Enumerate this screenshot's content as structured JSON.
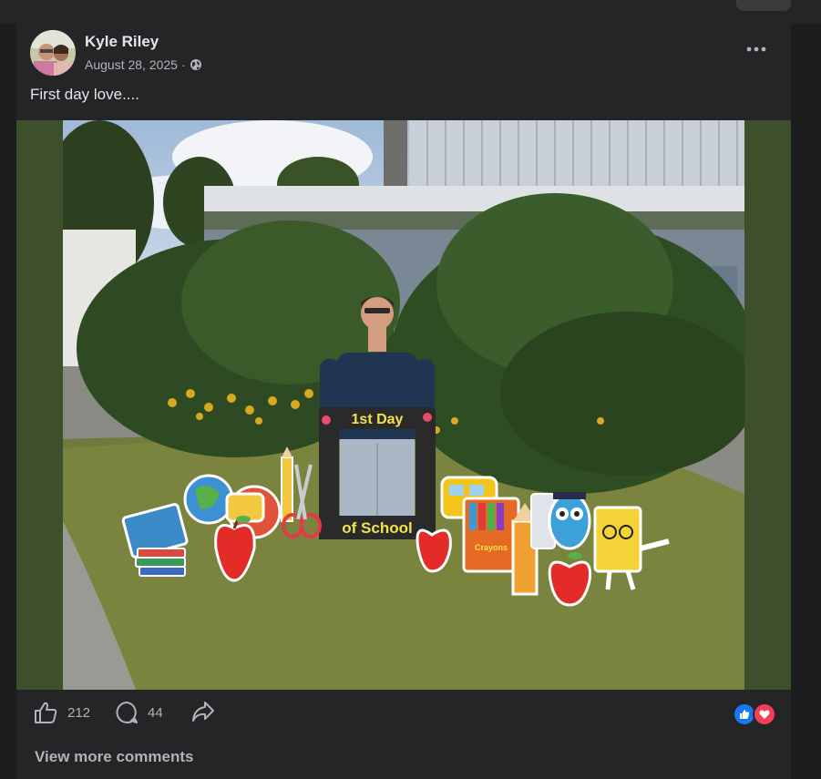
{
  "post": {
    "author": "Kyle Riley",
    "date": "August 28, 2025",
    "separator": "·",
    "caption": "First day love....",
    "privacy_icon": "globe-icon",
    "more_icon": "ellipsis-icon"
  },
  "photo": {
    "frame_sign_top": "1st Day",
    "frame_sign_bottom": "of School",
    "crayon_box_label": "Crayons"
  },
  "actions": {
    "like_count": "212",
    "comment_count": "44",
    "like_icon": "thumbs-up-icon",
    "comment_icon": "comment-bubble-icon",
    "share_icon": "share-arrow-icon"
  },
  "reactions": [
    "like-reaction-icon",
    "love-reaction-icon"
  ],
  "colors": {
    "background": "#18191a",
    "card": "#242526",
    "text": "#e4e6eb",
    "secondary_text": "#b0b3b8",
    "photo_letterbox": "#3e4f2b",
    "like_blue": "#1877f2",
    "love_red": "#f33e58"
  },
  "comments": {
    "view_more": "View more comments"
  }
}
